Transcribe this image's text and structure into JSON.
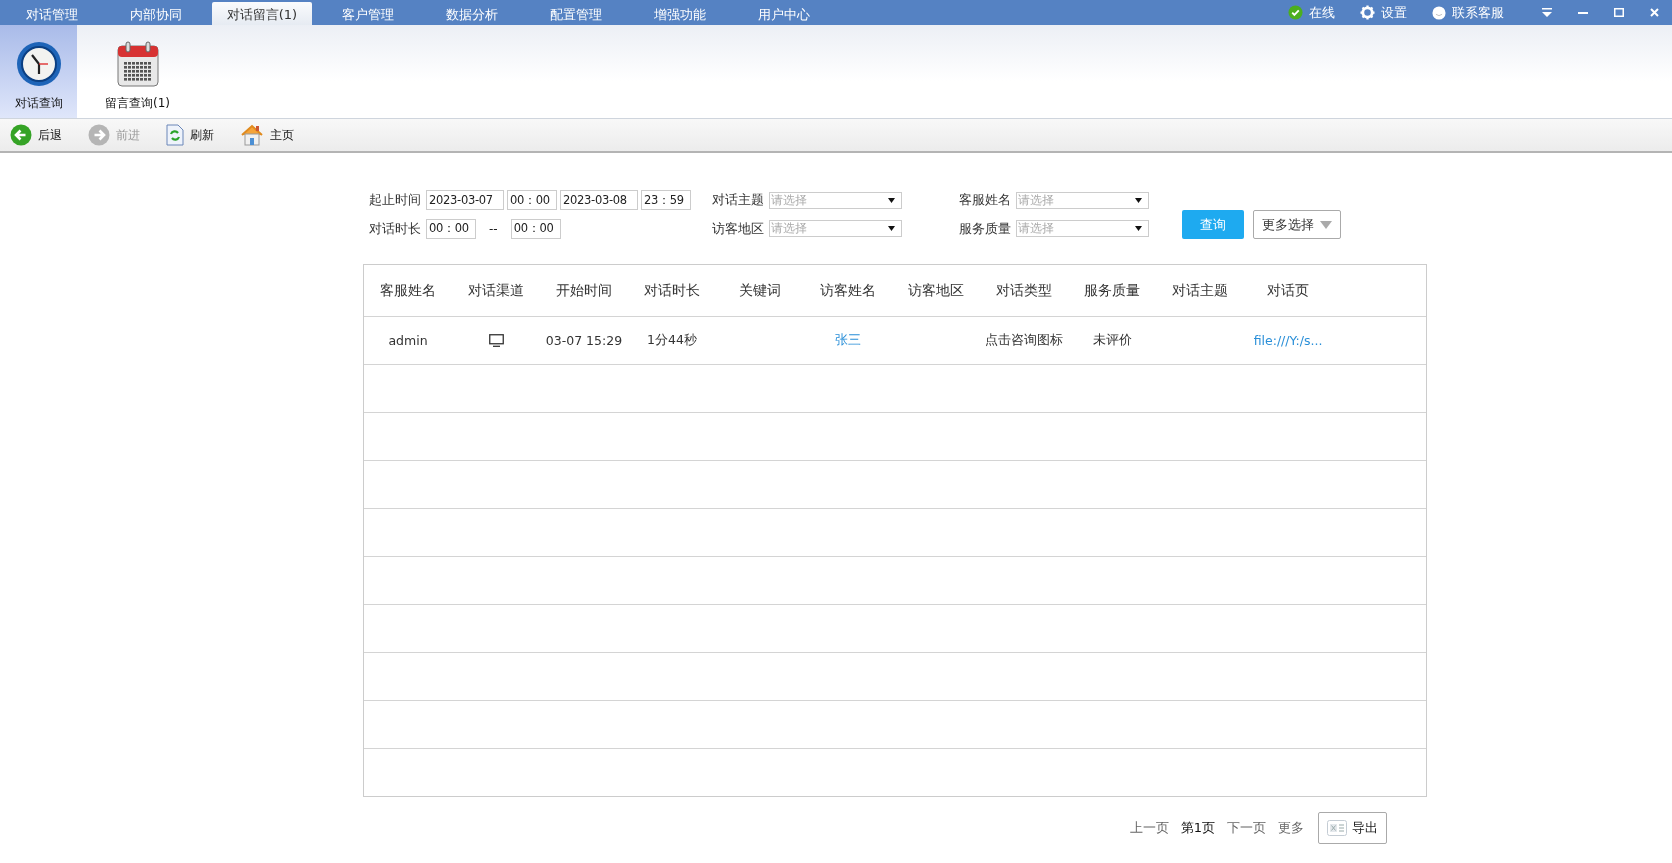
{
  "top_tabs": [
    {
      "label": "对话管理",
      "selected": false
    },
    {
      "label": "内部协同",
      "selected": false
    },
    {
      "label": "对话留言(1)",
      "selected": true
    },
    {
      "label": "客户管理",
      "selected": false
    },
    {
      "label": "数据分析",
      "selected": false
    },
    {
      "label": "配置管理",
      "selected": false
    },
    {
      "label": "增强功能",
      "selected": false
    },
    {
      "label": "用户中心",
      "selected": false
    }
  ],
  "status": {
    "label": "在线"
  },
  "top_actions": [
    {
      "label": "设置",
      "kind": "settings"
    },
    {
      "label": "联系客服",
      "kind": "chat"
    }
  ],
  "modules": [
    {
      "label": "对话查询",
      "selected": true,
      "kind": "clock"
    },
    {
      "label": "留言查询(1)",
      "selected": false,
      "kind": "calendar"
    }
  ],
  "nav": [
    {
      "label": "后退",
      "disabled": false,
      "kind": "back"
    },
    {
      "label": "前进",
      "disabled": true,
      "kind": "forward"
    },
    {
      "label": "刷新",
      "disabled": false,
      "kind": "refresh"
    },
    {
      "label": "主页",
      "disabled": false,
      "kind": "home"
    }
  ],
  "filters": {
    "time_range": {
      "label": "起止时间",
      "start_date": "2023-03-07",
      "start_time": "00：00",
      "end_date": "2023-03-08",
      "end_time": "23：59"
    },
    "duration": {
      "label": "对话时长",
      "from": "00：00",
      "separator": "--",
      "to": "00：00"
    },
    "selects": [
      {
        "label": "对话主题",
        "placeholder": "请选择"
      },
      {
        "label": "客服姓名",
        "placeholder": "请选择"
      },
      {
        "label": "访客地区",
        "placeholder": "请选择"
      },
      {
        "label": "服务质量",
        "placeholder": "请选择"
      }
    ],
    "query_button": "查询",
    "more_button": "更多选择"
  },
  "table": {
    "columns": [
      "客服姓名",
      "对话渠道",
      "开始时间",
      "对话时长",
      "关键词",
      "访客姓名",
      "访客地区",
      "对话类型",
      "服务质量",
      "对话主题",
      "对话页"
    ],
    "rows": [
      {
        "agent": "admin",
        "start": "03-07 15:29",
        "duration": "1分44秒",
        "visitor": "张三",
        "type": "点击咨询图标",
        "quality": "未评价",
        "page": "file:///Y:/s..."
      }
    ]
  },
  "pagination": [
    {
      "label": "上一页",
      "selected": false
    },
    {
      "label": "第1页",
      "selected": true
    },
    {
      "label": "下一页",
      "selected": false
    },
    {
      "label": "更多",
      "selected": false
    }
  ],
  "export_button": "导出"
}
